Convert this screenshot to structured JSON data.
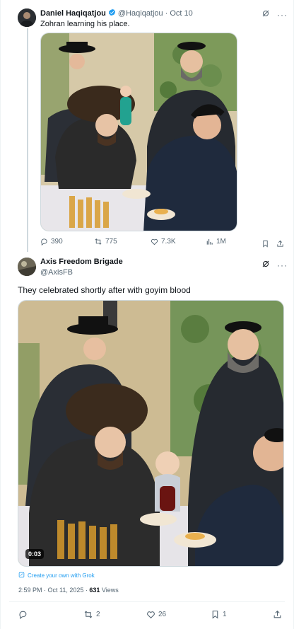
{
  "quoted_tweet": {
    "author_name": "Daniel Haqiqatjou",
    "handle": "@Haqiqatjou",
    "separator": "·",
    "date": "Oct 10",
    "text": "Zohran learning his place.",
    "stats": {
      "replies": "390",
      "reposts": "775",
      "likes": "7.3K",
      "views": "1M"
    }
  },
  "main_tweet": {
    "author_name": "Axis Freedom Brigade",
    "handle": "@AxisFB",
    "text": "They celebrated shortly after with goyim blood",
    "video_duration": "0:03",
    "grok_link": "Create your own with Grok",
    "timestamp": "2:59 PM · Oct 11, 2025 · ",
    "views_count": "631",
    "views_label": " Views",
    "stats": {
      "replies": "",
      "reposts": "2",
      "likes": "26",
      "bookmarks": "1"
    }
  },
  "colors": {
    "accent": "#1d9bf0",
    "muted": "#536471",
    "border": "#cfd9de"
  }
}
